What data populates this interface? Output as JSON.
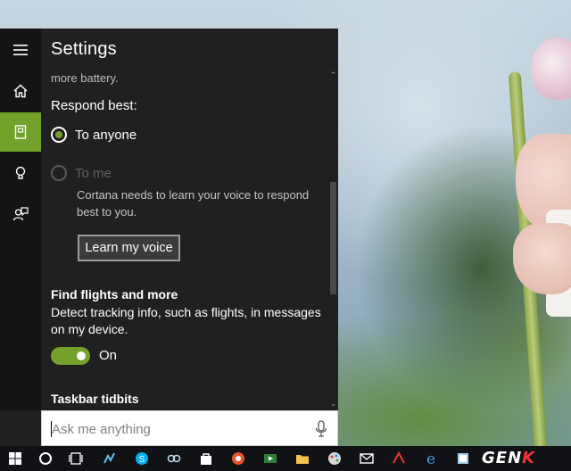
{
  "panel": {
    "title": "Settings",
    "rail_items": [
      "hamburger-icon",
      "home-icon",
      "notebook-icon",
      "lightbulb-icon",
      "feedback-icon"
    ],
    "accent_color": "#74a12a"
  },
  "content": {
    "partial_text": "more battery.",
    "respond_best_label": "Respond best:",
    "respond_options": [
      {
        "label": "To anyone",
        "selected": true
      },
      {
        "label": "To me",
        "selected": false,
        "disabled": true
      }
    ],
    "cortana_note": "Cortana needs to learn your voice to respond best to you.",
    "learn_voice_button": "Learn my voice",
    "flights_title": "Find flights and more",
    "flights_desc": "Detect tracking info, such as flights, in messages on my device.",
    "flights_toggle": {
      "state": "On",
      "on": true
    },
    "taskbar_tidbits_title": "Taskbar tidbits"
  },
  "search": {
    "placeholder": "Ask me anything",
    "value": ""
  },
  "taskbar": {
    "items": [
      "windows-start-icon",
      "cortana-circle-icon",
      "task-view-icon",
      "app-icon",
      "skype-icon",
      "link-icon",
      "store-icon",
      "app-icon",
      "video-icon",
      "file-explorer-icon",
      "paint-icon",
      "mail-icon",
      "app-icon",
      "edge-icon",
      "app-icon"
    ],
    "watermark": "GENK"
  }
}
